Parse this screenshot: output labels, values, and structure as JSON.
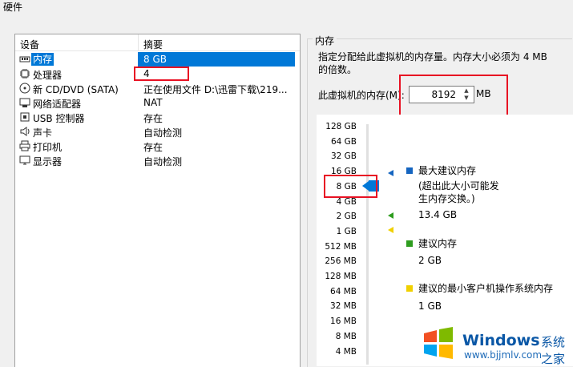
{
  "window": {
    "title": "硬件"
  },
  "devices": {
    "col_device": "设备",
    "col_summary": "摘要",
    "items": [
      {
        "name": "内存",
        "summary": "8 GB",
        "icon": "memory-icon",
        "selected": true
      },
      {
        "name": "处理器",
        "summary": "4",
        "icon": "cpu-icon",
        "selected": false
      },
      {
        "name": "新 CD/DVD (SATA)",
        "summary": "正在使用文件 D:\\迅雷下载\\219...",
        "icon": "cd-icon",
        "selected": false
      },
      {
        "name": "网络适配器",
        "summary": "NAT",
        "icon": "network-icon",
        "selected": false
      },
      {
        "name": "USB 控制器",
        "summary": "存在",
        "icon": "usb-icon",
        "selected": false
      },
      {
        "name": "声卡",
        "summary": "自动检测",
        "icon": "speaker-icon",
        "selected": false
      },
      {
        "name": "打印机",
        "summary": "存在",
        "icon": "printer-icon",
        "selected": false
      },
      {
        "name": "显示器",
        "summary": "自动检测",
        "icon": "monitor-icon",
        "selected": false
      }
    ]
  },
  "memory": {
    "group_title": "内存",
    "description": "指定分配给此虚拟机的内存量。内存大小必须为 4 MB 的倍数。",
    "field_label": "此虚拟机的内存(M):",
    "value": "8192",
    "unit": "MB",
    "scale_labels": [
      "128 GB",
      "64 GB",
      "32 GB",
      "16 GB",
      "8 GB",
      "4 GB",
      "2 GB",
      "1 GB",
      "512 MB",
      "256 MB",
      "128 MB",
      "64 MB",
      "32 MB",
      "16 MB",
      "8 MB",
      "4 MB"
    ],
    "current_label": "8 GB",
    "legend": {
      "max_title": "最大建议内存",
      "max_note": "(超出此大小可能发生内存交换。)",
      "max_value": "13.4 GB",
      "rec_title": "建议内存",
      "rec_value": "2 GB",
      "min_title": "建议的最小客户机操作系统内存",
      "min_value": "1 GB"
    },
    "colors": {
      "max": "#1565c0",
      "rec": "#2e9d1f",
      "min": "#f0d000",
      "slider": "#0078d7"
    }
  },
  "watermark": {
    "brand": "Windows",
    "brand_cn": "系统之家",
    "url": "www.bjjmlv.com"
  }
}
